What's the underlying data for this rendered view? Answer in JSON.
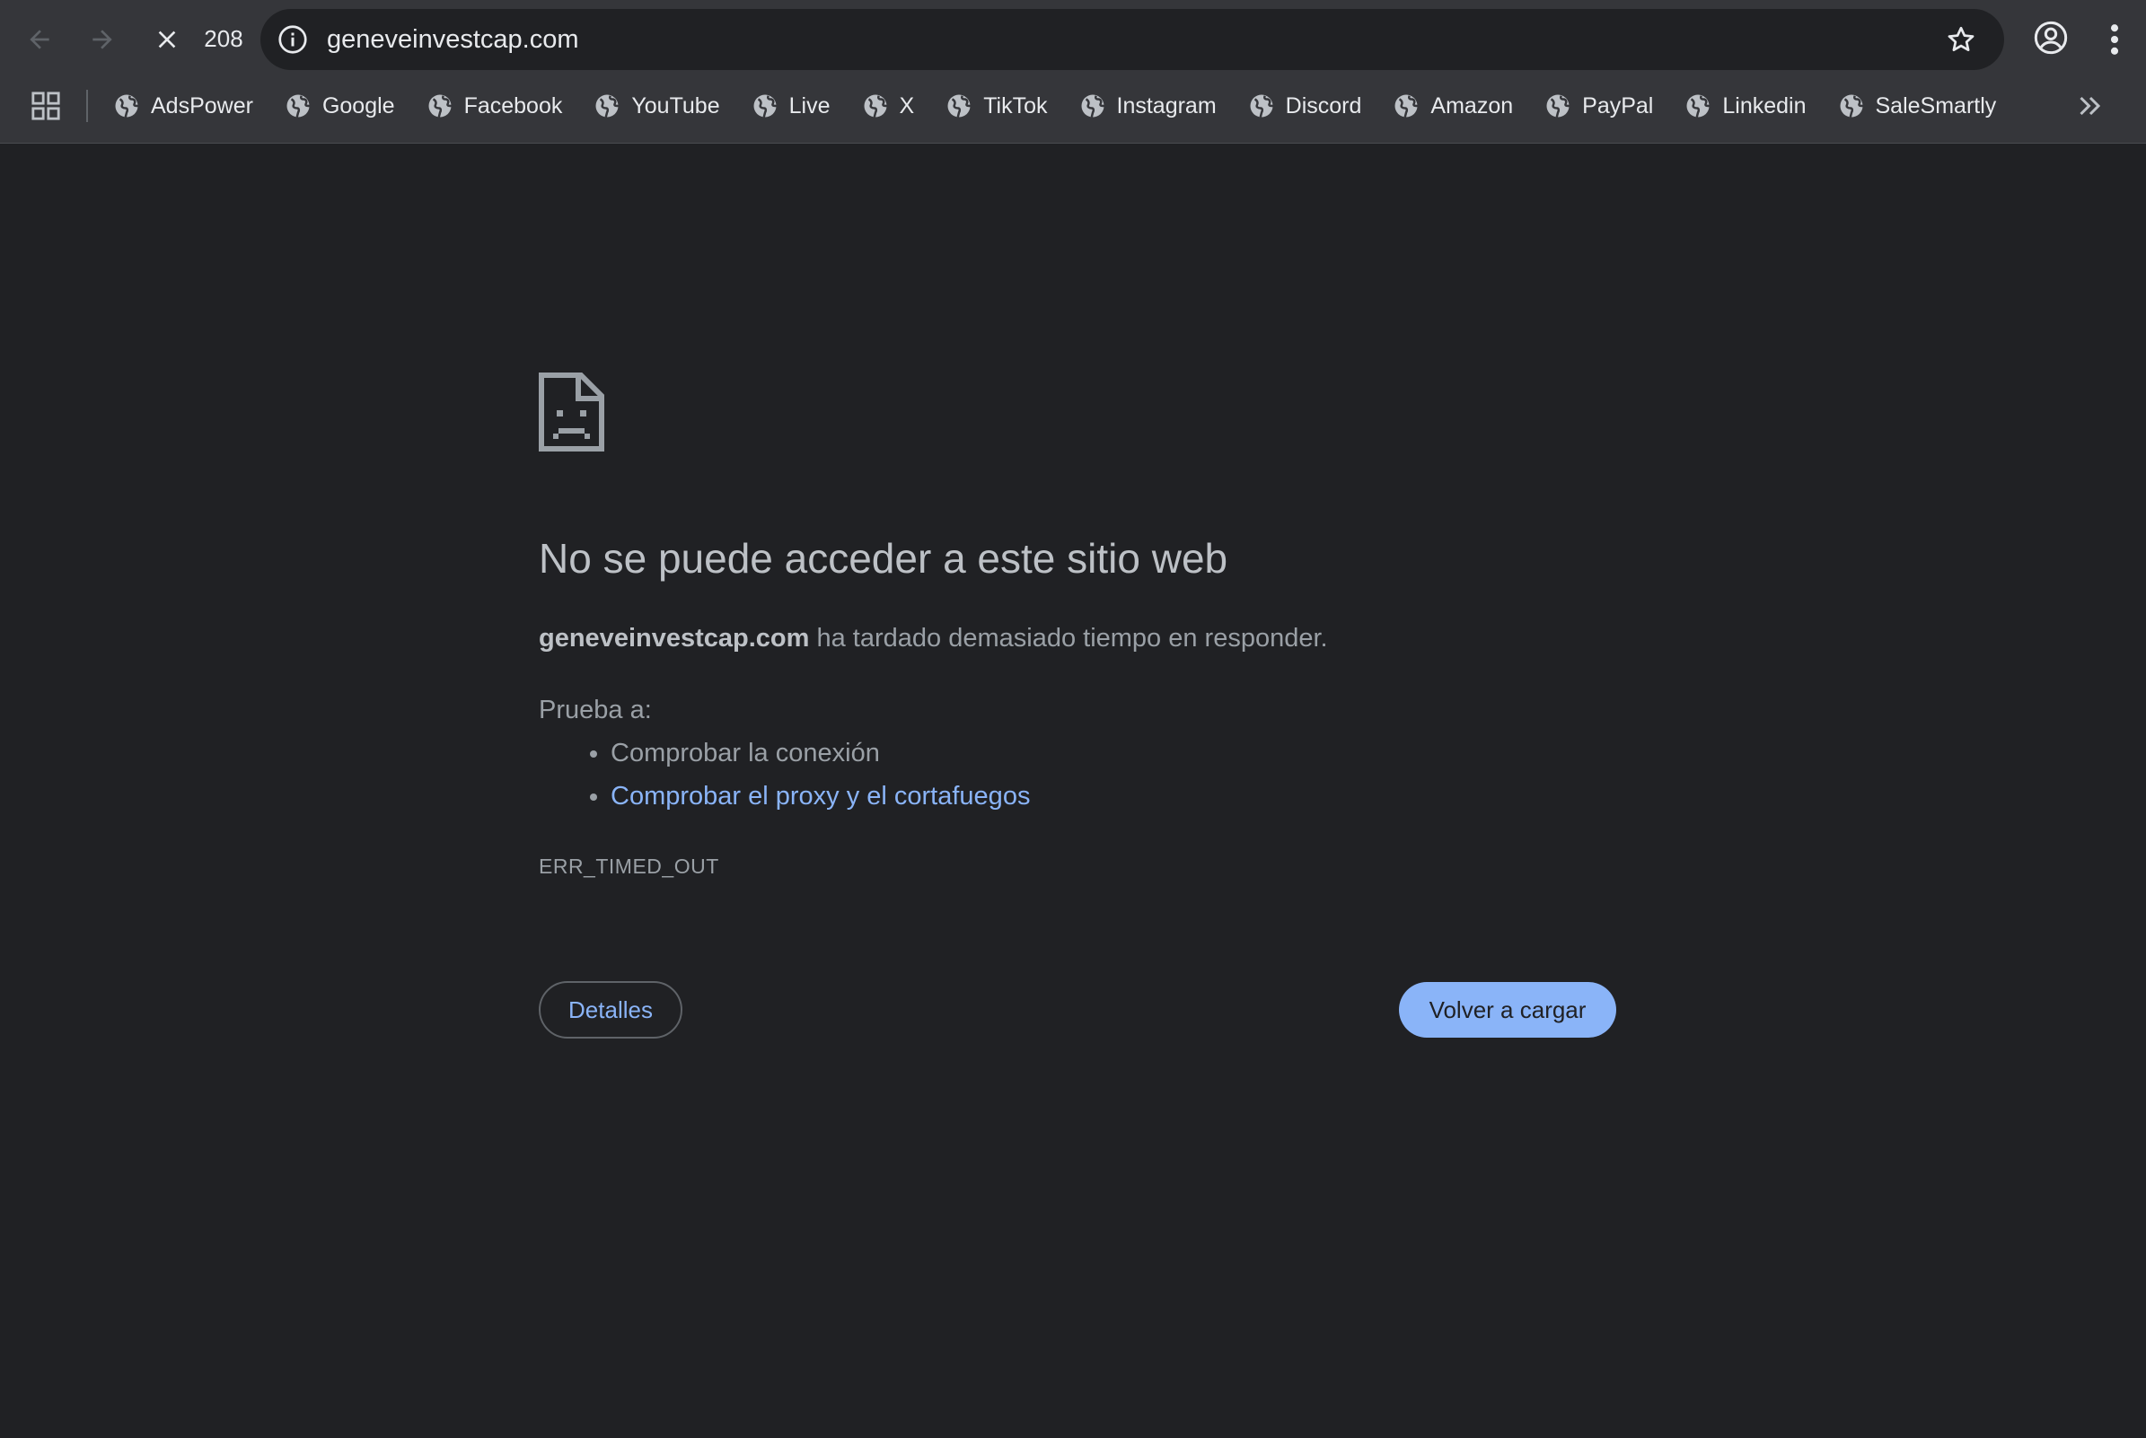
{
  "browser": {
    "tab_count": "208",
    "url": "geneveinvestcap.com"
  },
  "bookmarks": [
    {
      "label": "AdsPower",
      "icon": "globe-icon"
    },
    {
      "label": "Google",
      "icon": "globe-icon"
    },
    {
      "label": "Facebook",
      "icon": "globe-icon"
    },
    {
      "label": "YouTube",
      "icon": "globe-icon"
    },
    {
      "label": "Live",
      "icon": "globe-icon"
    },
    {
      "label": "X",
      "icon": "globe-icon"
    },
    {
      "label": "TikTok",
      "icon": "globe-icon"
    },
    {
      "label": "Instagram",
      "icon": "globe-icon"
    },
    {
      "label": "Discord",
      "icon": "globe-icon"
    },
    {
      "label": "Amazon",
      "icon": "globe-icon"
    },
    {
      "label": "PayPal",
      "icon": "globe-icon"
    },
    {
      "label": "Linkedin",
      "icon": "globe-icon"
    },
    {
      "label": "SaleSmartly",
      "icon": "globe-icon"
    }
  ],
  "error": {
    "headline": "No se puede acceder a este sitio web",
    "domain": "geneveinvestcap.com",
    "description_rest": " ha tardado demasiado tiempo en responder.",
    "suggestions_label": "Prueba a:",
    "suggestions": [
      "Comprobar la conexión",
      "Comprobar el proxy y el cortafuegos"
    ],
    "code": "ERR_TIMED_OUT",
    "details_button": "Detalles",
    "reload_button": "Volver a cargar"
  },
  "colors": {
    "background": "#202124",
    "toolbar": "#35363a",
    "link": "#8ab4f8",
    "button_primary": "#8ab4f8"
  }
}
